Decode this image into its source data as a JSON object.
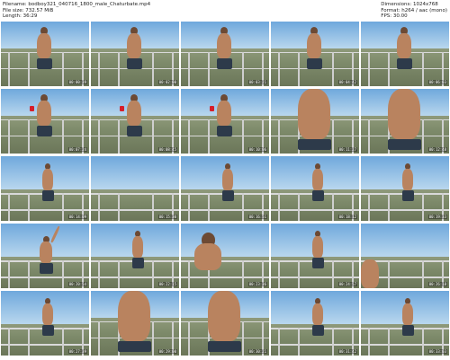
{
  "header": {
    "filename": "Filename: bodboy321_040716_1800_male_Chaturbate.mp4",
    "filesize": "File size: 732.57 MiB",
    "length": "Length: 36:29",
    "dimensions": "Dimensions: 1024x768",
    "format": "Format: h264 / aac (mono)",
    "fps": "FPS: 30.00"
  },
  "thumbnails": [
    {
      "time": "00:00:39",
      "scene": "standing-balcony"
    },
    {
      "time": "00:02:00",
      "scene": "standing-balcony"
    },
    {
      "time": "00:03:21",
      "scene": "standing-balcony"
    },
    {
      "time": "00:04:42",
      "scene": "standing-balcony"
    },
    {
      "time": "00:06:03",
      "scene": "standing-balcony"
    },
    {
      "time": "00:07:24",
      "scene": "standing-cup"
    },
    {
      "time": "00:08:45",
      "scene": "standing-cup"
    },
    {
      "time": "00:10:06",
      "scene": "standing-cup"
    },
    {
      "time": "00:11:27",
      "scene": "closeup-torso"
    },
    {
      "time": "00:12:48",
      "scene": "closeup-torso"
    },
    {
      "time": "00:14:09",
      "scene": "standing-wide"
    },
    {
      "time": "00:15:30",
      "scene": "empty-balcony"
    },
    {
      "time": "00:16:51",
      "scene": "standing-wide"
    },
    {
      "time": "00:18:12",
      "scene": "standing-wide"
    },
    {
      "time": "00:19:33",
      "scene": "standing-wide"
    },
    {
      "time": "00:20:54",
      "scene": "arm-raised"
    },
    {
      "time": "00:22:15",
      "scene": "standing-wide"
    },
    {
      "time": "00:23:36",
      "scene": "leaning-close"
    },
    {
      "time": "00:24:57",
      "scene": "standing-wide"
    },
    {
      "time": "00:26:18",
      "scene": "partial-edge"
    },
    {
      "time": "00:27:39",
      "scene": "standing-wide"
    },
    {
      "time": "00:29:00",
      "scene": "closeup-torso"
    },
    {
      "time": "00:30:21",
      "scene": "closeup-torso"
    },
    {
      "time": "00:31:42",
      "scene": "standing-wide"
    },
    {
      "time": "00:33:03",
      "scene": "standing-wide"
    }
  ],
  "colors": {
    "sky_top": "#6fa8dc",
    "sky_bottom": "#b9d7ee",
    "ground": "#7d8a6a",
    "skin": "#b9835f"
  }
}
